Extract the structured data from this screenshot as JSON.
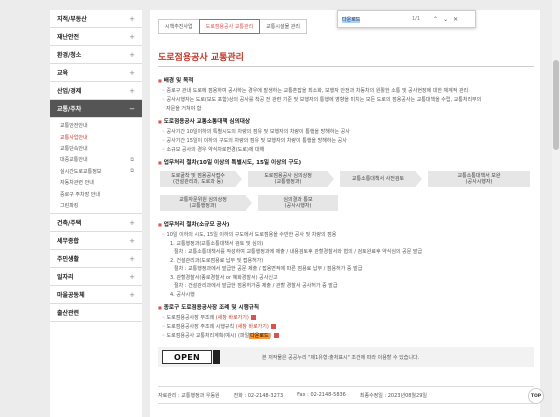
{
  "sidebar": {
    "items": [
      {
        "label": "지적/부동산"
      },
      {
        "label": "재난안전"
      },
      {
        "label": "환경/청소"
      },
      {
        "label": "교육"
      },
      {
        "label": "산업/경제"
      },
      {
        "label": "교통/주차",
        "active": true
      }
    ],
    "sub_items": [
      {
        "label": "교통안전안내",
        "ext": false
      },
      {
        "label": "교통사업안내",
        "ext": false,
        "current": true
      },
      {
        "label": "교통단속안내",
        "ext": false
      },
      {
        "label": "대중교통안내",
        "ext": true
      },
      {
        "label": "실시간도로교통정보",
        "ext": true
      },
      {
        "label": "자동차관련 안내",
        "ext": false
      },
      {
        "label": "중로구 주차장 안내",
        "ext": false
      },
      {
        "label": "그린파킹",
        "ext": false
      }
    ],
    "after_items": [
      {
        "label": "건축/주택"
      },
      {
        "label": "세무종합"
      },
      {
        "label": "주민생활"
      },
      {
        "label": "일자리"
      },
      {
        "label": "마을공동체"
      },
      {
        "label": "출산관련"
      }
    ]
  },
  "tabs": [
    "시책추진사업",
    "도로점용공사 교통관리",
    "교통시설물 관리"
  ],
  "find_bar": {
    "query": "다운로드",
    "count": "1/1"
  },
  "page_title": "도로점용공사 교통관리",
  "sections": {
    "purpose": {
      "title": "배경 및 목적",
      "lines": [
        "중로구 관내 도로에 점용하여 공사하는 경우에 발생하는 교통혼잡을 최소화, 보행자 안전과 차동차의 원활한 소통 및 공사현장에 대한 체계적 관리",
        "공사시행자는 도로(보도 포함)상의 공사를 착공 전 관련 기준 및 보행자의 통행에 영향을 미치는 모든 도로의 점용공사는 교통대책을 수립, 교통처리부의",
        "자문을 거쳐야 함"
      ]
    },
    "targets": {
      "title": "도로점용공사 교통소통대책 심의대상",
      "lines": [
        "공사기간 10일이하의 특별시도의 차량의 점유 및 보행자의 차량이 통행을 방해하는 공사",
        "공사기간 15일이 이하의 구도의 차량의 점유 및 보행자의 차량이 통행을 방해하는 공사",
        "소규모 공사의 경우 약식차로변경(도로)에 대해"
      ]
    },
    "procedure": {
      "title": "업무처리 절차(10일 이상의 특별시도, 15일 이상의 구도)",
      "flow": [
        "도로굴착 및 점용공사접수\n(건설관리과, 도로과 등)",
        "도로점용공사 심의상정\n(교통행정과)",
        "교통소통대책서 사전검토",
        "교통소통대책서 보완\n(공사시행자)",
        "교통자문위원 심의상정\n(교통행정과)",
        "심의결과 통보\n(공사시행자)"
      ]
    },
    "small": {
      "title": "업무처리 절차(소규모 공사)",
      "lines": [
        "10일 이하의 시도, 15일 이하의 구도에서 도로점용을 수반한 공사 및 차량의 점용",
        "1. 교통행정과(교통소통대책서 검토 및 심의)",
        "절차 : 교통소통대책서를 작성하여 교통행정과에 제출 / 내용검토후 관할경찰서와 협의 / 검토완료후 약식심의 공문 발급",
        "2. 건설관리과(도로점용료 납부 및 접용허가)",
        "절차 : 교통행정과에서 발급한 공문 제출 / 접용면적에 따른 점용료 납부 / 점용허가 증 발급",
        "3. 관할경찰서(종로경찰서 or 혜화경찰서) 공사신고",
        "절차 : 건설관리과에서 발급한 점용허가증 제출 / 관할 경찰서 공사허가 증 발급",
        "4. 공사시행"
      ]
    },
    "rules": {
      "title": "종로구 도로점용공사장 조례 및 시행규칙",
      "links": [
        {
          "text": "도로점용공사장 무조례",
          "suffix": "(새창 바로가기)"
        },
        {
          "text": "도로점용공사장 주조례 시행규칙",
          "suffix": "(새창 바로가기)"
        },
        {
          "text": "도로점용공사 교통처리계획(예시) (파일",
          "highlight": "다운로드",
          "suffix": ")"
        }
      ]
    }
  },
  "open_license": {
    "logo": "OPEN",
    "text": "본 저작물은 공공누리 \"제1유형:출처표시\" 조건에 따라 이용할 수 있습니다."
  },
  "footer": {
    "dept": "자료관리 : 교통행정과 우동원",
    "phone": "전화 : 02-2148-3273",
    "fax": "Fax : 02-2148-5836",
    "updated": "최종수정일 : 2023년08월29일"
  },
  "top_button": "TOP",
  "colors": {
    "accent": "#c0392b",
    "active_nav": "#555555"
  }
}
